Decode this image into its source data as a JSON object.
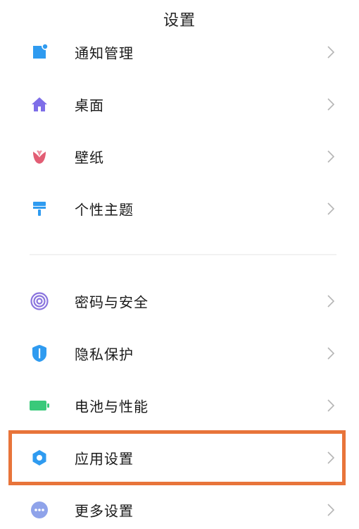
{
  "header": {
    "title": "设置"
  },
  "items": [
    {
      "label": "通知管理",
      "icon": "notification-icon",
      "color": "#2f9bf0"
    },
    {
      "label": "桌面",
      "icon": "home-icon",
      "color": "#7e6ee8"
    },
    {
      "label": "壁纸",
      "icon": "tulip-icon",
      "color": "#e25d74"
    },
    {
      "label": "个性主题",
      "icon": "brush-icon",
      "color": "#2f9bf0"
    },
    {
      "label": "密码与安全",
      "icon": "fingerprint-icon",
      "color": "#8a74de"
    },
    {
      "label": "隐私保护",
      "icon": "privacy-shield-icon",
      "color": "#2f9bf0"
    },
    {
      "label": "电池与性能",
      "icon": "battery-icon",
      "color": "#39c97a"
    },
    {
      "label": "应用设置",
      "icon": "gear-icon",
      "color": "#2f9bf0"
    },
    {
      "label": "更多设置",
      "icon": "more-icon",
      "color": "#8fa3ea"
    }
  ],
  "highlight": {
    "target": "应用设置",
    "color": "#e8743a"
  }
}
